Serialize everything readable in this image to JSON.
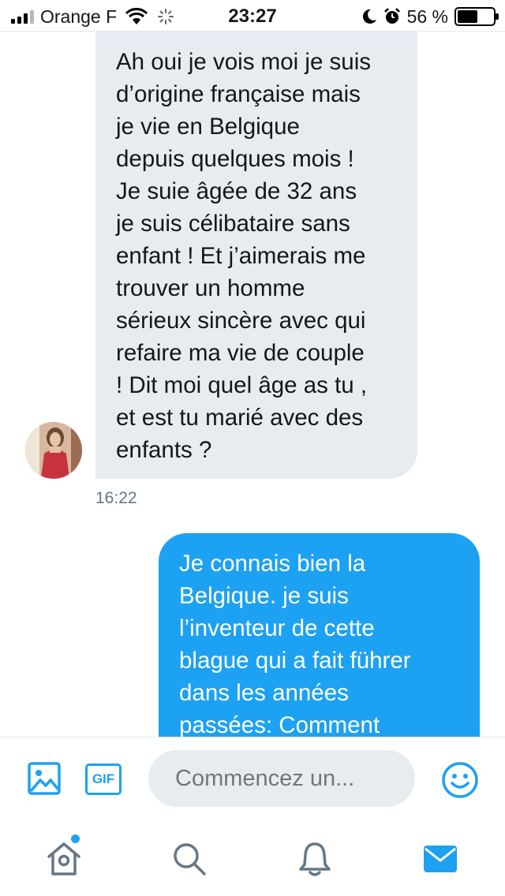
{
  "status_bar": {
    "carrier": "Orange F",
    "time": "23:27",
    "battery_percent": "56 %",
    "battery_level": 0.56,
    "signal_bars": 3,
    "icons": [
      "signal-icon",
      "wifi-icon",
      "activity-spinner-icon",
      "moon-icon",
      "alarm-icon",
      "battery-icon"
    ]
  },
  "conversation": {
    "received_message": {
      "lines": [
        "Ah oui je vois moi je suis",
        "d’origine française mais",
        "je vie en Belgique",
        "depuis quelques mois !",
        "Je suie âgée de 32 ans",
        "je suis célibataire sans",
        "enfant ! Et j’aimerais me",
        "trouver un homme",
        "sérieux sincère avec qui",
        "refaire ma vie de couple",
        "! Dit moi quel âge as tu ,",
        "et est tu marié avec des",
        "enfants ?"
      ],
      "time": "16:22"
    },
    "sent_message": {
      "lines": [
        "Je connais bien la",
        "Belgique. je suis",
        "l’inventeur de cette",
        "blague qui a fait führer",
        "dans les années",
        "passées: Comment"
      ]
    }
  },
  "composer": {
    "gif_label": "GIF",
    "placeholder": "Commencez un...",
    "icons": [
      "image-icon",
      "gif-icon",
      "emoji-icon"
    ]
  },
  "tab_bar": {
    "tabs": [
      {
        "name": "home",
        "icon": "home-icon",
        "badge": true
      },
      {
        "name": "search",
        "icon": "search-icon"
      },
      {
        "name": "notifications",
        "icon": "bell-icon"
      },
      {
        "name": "messages",
        "icon": "mail-icon",
        "active": true
      }
    ]
  },
  "colors": {
    "accent": "#1da1f2",
    "received_bubble": "#e6ecf0",
    "icon_gray": "#657786"
  }
}
